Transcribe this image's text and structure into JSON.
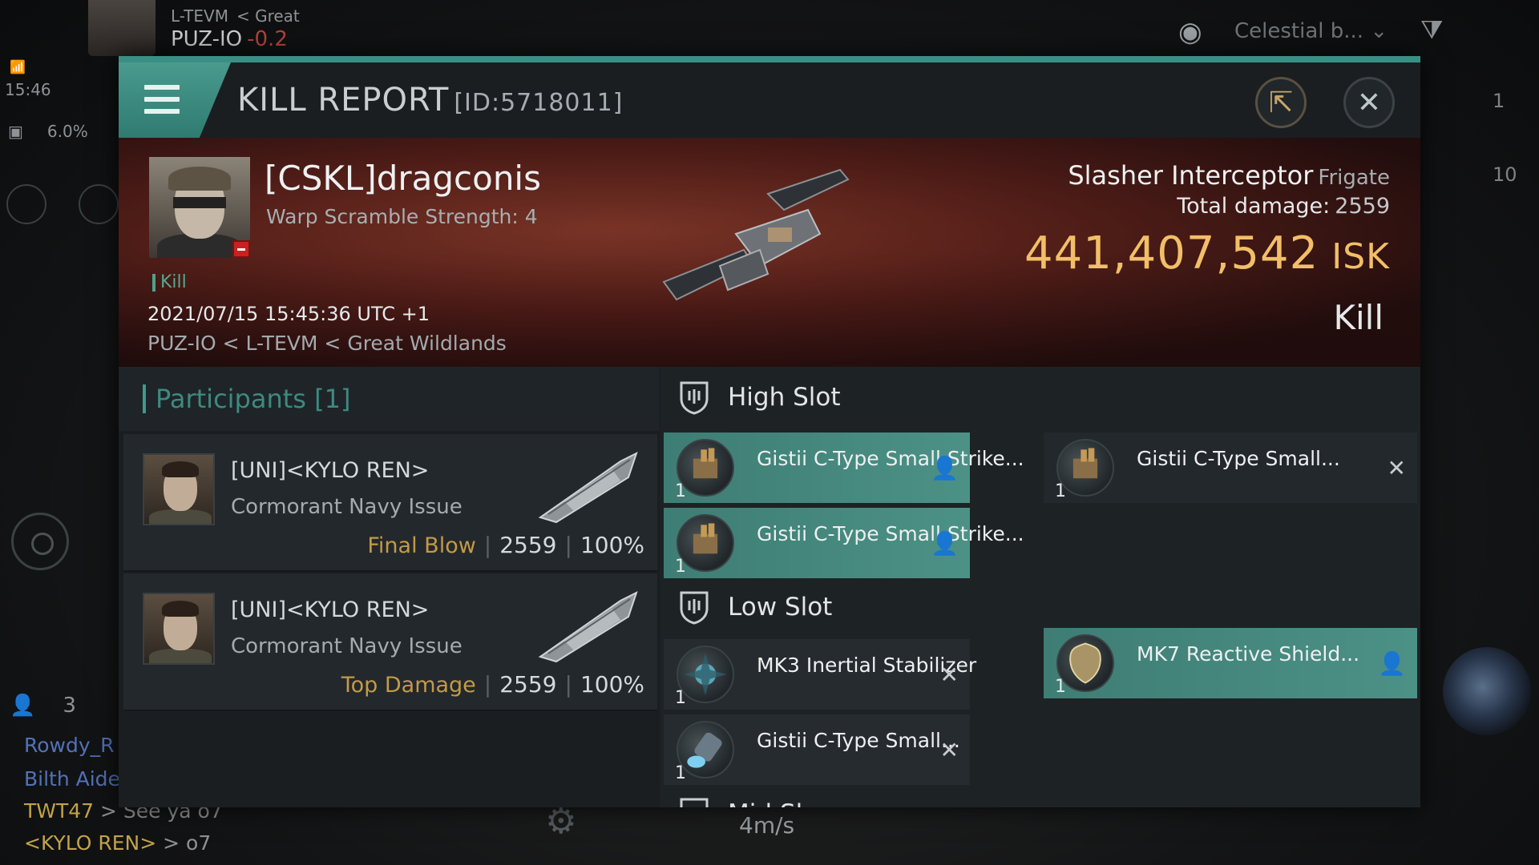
{
  "hud": {
    "system_path_small": [
      "L-TEVM",
      "< Great"
    ],
    "system_name": "PUZ-IO",
    "security": "-0.2",
    "time": "15:46",
    "cargo_percent": "6.0%",
    "overview_filter": "Celestial b...",
    "side_count_1": "1",
    "side_count_2": "10",
    "fleet_count": "3",
    "speed": "4m/s",
    "chat": [
      {
        "name": "Rowdy_R",
        "msg": ""
      },
      {
        "name": "Bilth Aide",
        "msg": ""
      },
      {
        "name": "TWT47",
        "msg": " > See ya o7"
      },
      {
        "name": "<KYLO REN>",
        "msg": " > o7"
      }
    ]
  },
  "dialog": {
    "title": "KILL REPORT",
    "report_id": "[ID:5718011]"
  },
  "victim": {
    "name": "[CSKL]dragconis",
    "warp_scramble": "Warp Scramble Strength: 4",
    "kill_tag": "Kill",
    "datetime": "2021/07/15 15:45:36 UTC +1",
    "location": "PUZ-IO < L-TEVM < Great Wildlands",
    "ship": "Slasher Interceptor",
    "ship_class": "Frigate",
    "total_damage_label": "Total damage:",
    "total_damage": "2559",
    "isk_value": "441,407,542",
    "isk_unit": "ISK",
    "result": "Kill"
  },
  "participants": {
    "title": "Participants [1]",
    "rows": [
      {
        "name": "[UNI]<KYLO REN>",
        "ship": "Cormorant Navy Issue",
        "role": "Final Blow",
        "damage": "2559",
        "percent": "100%"
      },
      {
        "name": "[UNI]<KYLO REN>",
        "ship": "Cormorant Navy Issue",
        "role": "Top Damage",
        "damage": "2559",
        "percent": "100%"
      }
    ]
  },
  "fitting": {
    "high_slot_label": "High Slot",
    "low_slot_label": "Low Slot",
    "mid_slot_label": "Mid Sl...",
    "high_items": [
      {
        "name": "Gistii C-Type Small Strike...",
        "qty": "1",
        "status": "dropped"
      },
      {
        "name": "Gistii C-Type Small...",
        "qty": "1",
        "status": "destroyed"
      },
      {
        "name": "Gistii C-Type Small Strike...",
        "qty": "1",
        "status": "dropped"
      }
    ],
    "low_items": [
      {
        "name": "MK3 Inertial Stabilizer",
        "qty": "1",
        "status": "destroyed"
      },
      {
        "name": "MK7 Reactive Shield...",
        "qty": "1",
        "status": "dropped"
      },
      {
        "name": "Gistii C-Type Small...",
        "qty": "1",
        "status": "destroyed"
      }
    ]
  },
  "colors": {
    "accent": "#3a8f84",
    "isk": "#f2bf68",
    "final_blow": "#c49a46",
    "security_negative": "#b3443c"
  }
}
